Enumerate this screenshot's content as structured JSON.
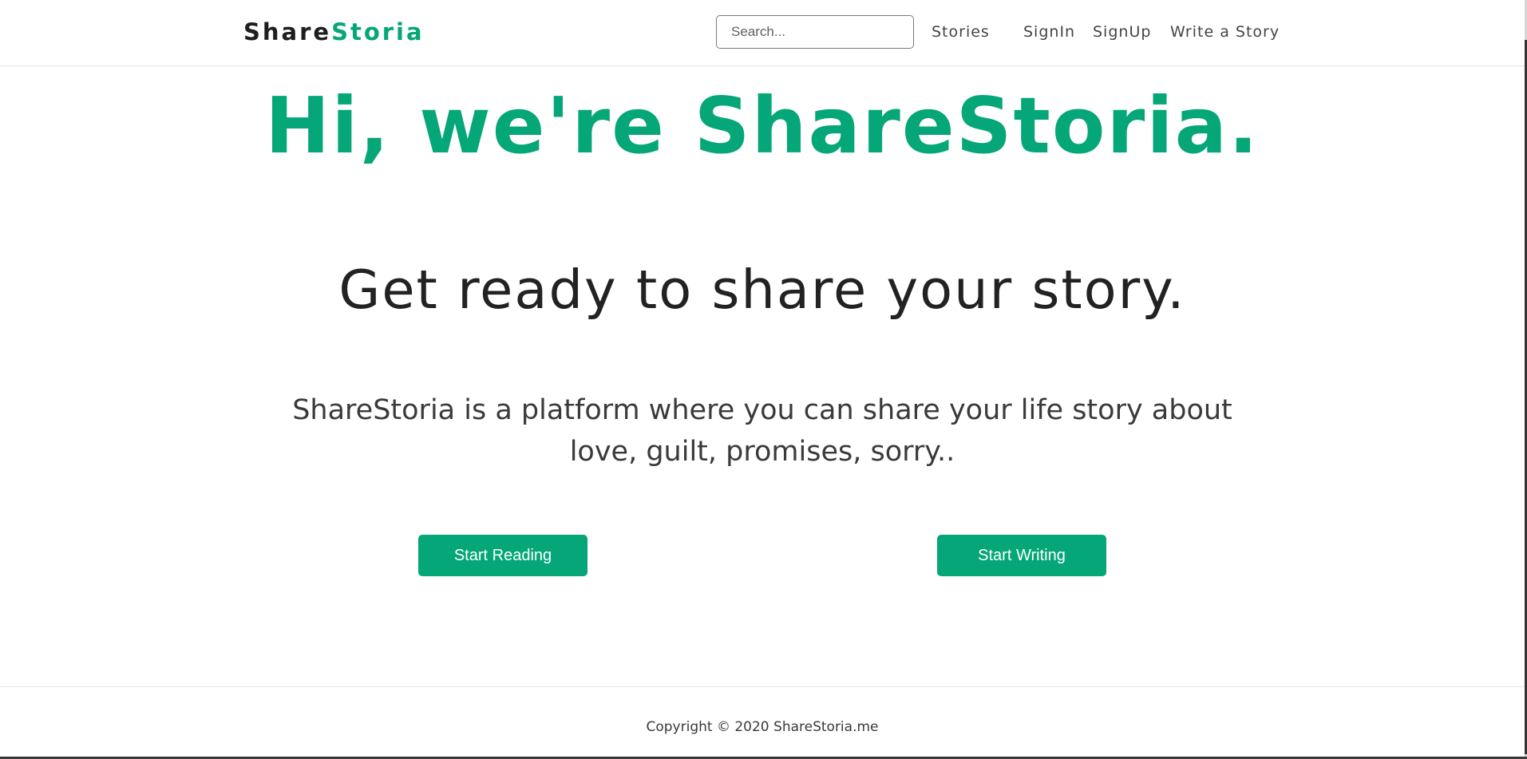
{
  "header": {
    "brand_part1": "Share",
    "brand_part2": "Storia",
    "search": {
      "placeholder": "Search...",
      "value": ""
    },
    "nav": [
      {
        "label": "Stories"
      },
      {
        "label": "SignIn"
      },
      {
        "label": "SignUp"
      },
      {
        "label": "Write a Story"
      }
    ]
  },
  "hero": {
    "title": "Hi, we're ShareStoria.",
    "subtitle": "Get ready to share your story.",
    "description": "ShareStoria is a platform where you can share your life story about love, guilt, promises, sorry..",
    "buttons": {
      "read_label": "Start Reading",
      "write_label": "Start Writing"
    }
  },
  "footer": {
    "copyright": "Copyright © 2020 ShareStoria.me"
  },
  "colors": {
    "accent": "#05a678",
    "text_dark": "#222222",
    "text_body": "#3a3a3a",
    "background": "#ffffff"
  }
}
